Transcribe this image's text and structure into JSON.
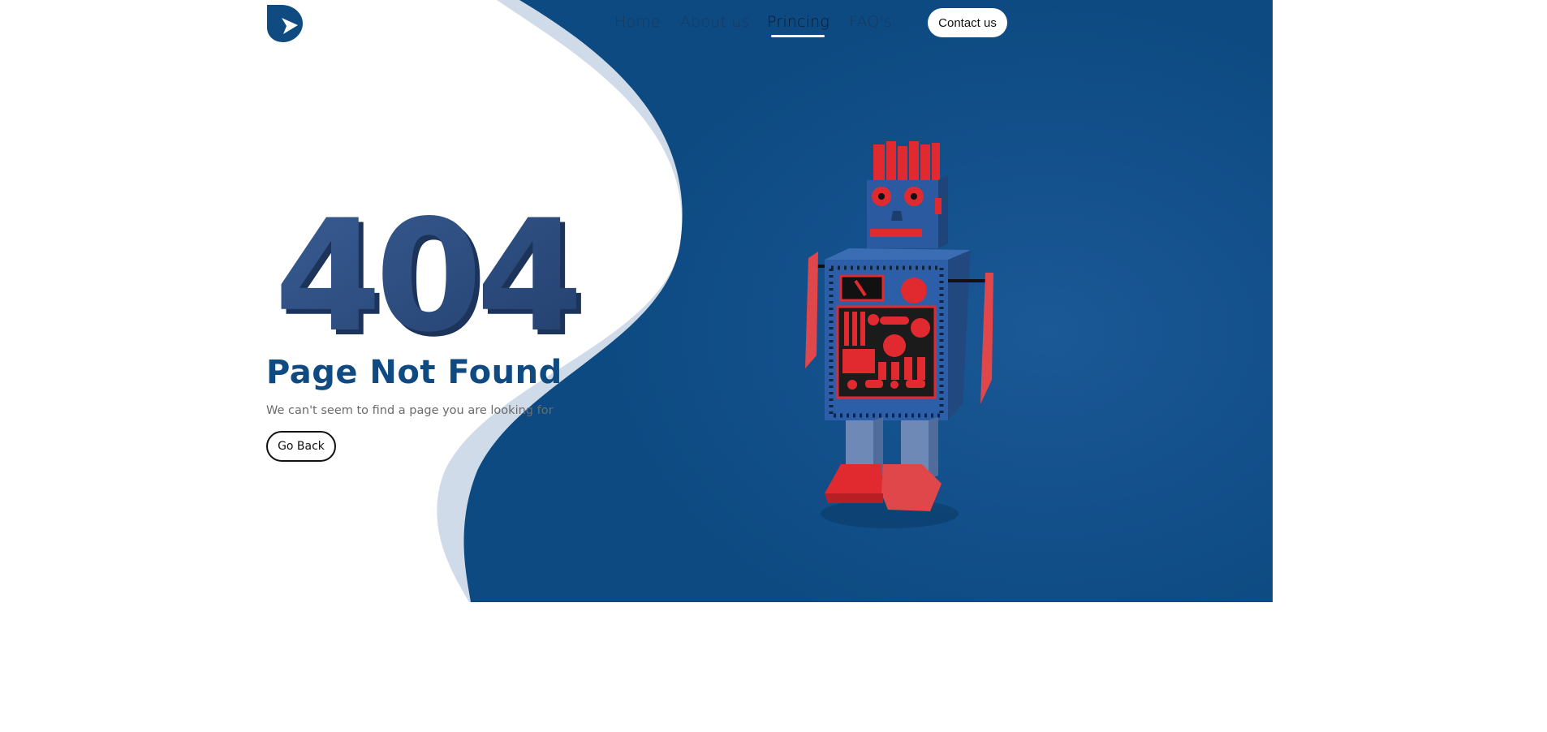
{
  "nav": {
    "links": [
      {
        "label": "Home"
      },
      {
        "label": "About us"
      },
      {
        "label": "Princing",
        "active": true
      },
      {
        "label": "FAQ's"
      }
    ],
    "contact_label": "Contact us"
  },
  "hero": {
    "big_number": "404",
    "title": "Page Not Found",
    "subtitle": "We can't seem to find a page you are looking for",
    "button_label": "Go Back"
  },
  "colors": {
    "brand_blue": "#0f4a80",
    "light_wave": "#cfdbe8",
    "digit_blue": "#2d4f82",
    "robot_red": "#e02a2f"
  },
  "icons": {
    "logo": "brand-logo-icon",
    "illustration": "robot-illustration"
  }
}
